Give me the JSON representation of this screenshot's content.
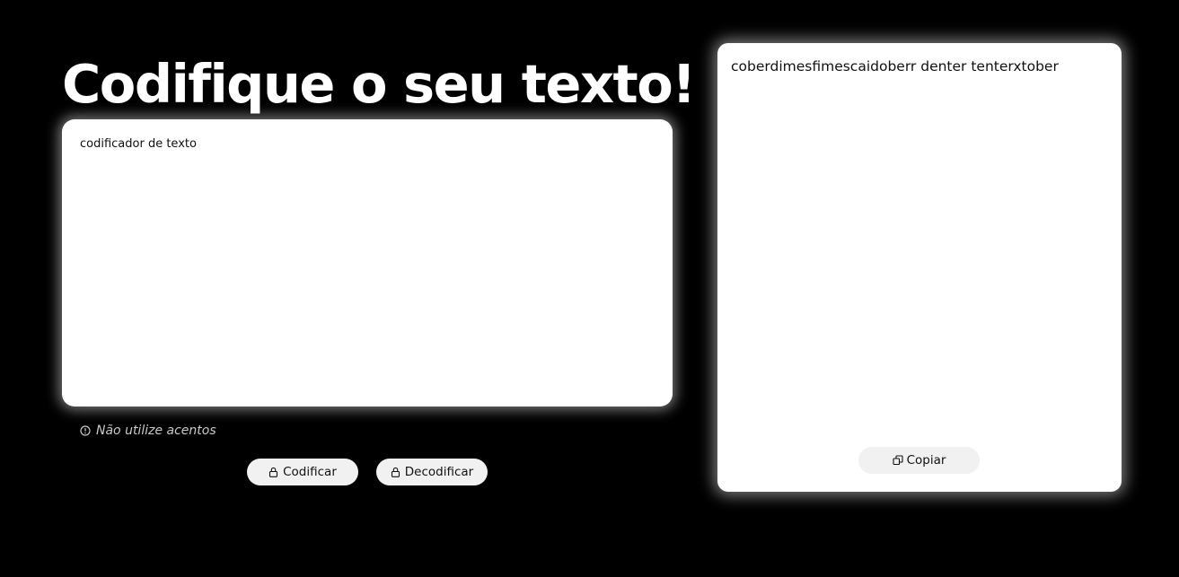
{
  "header": {
    "title": "Codifique o seu texto!"
  },
  "input": {
    "value": "codificador de texto",
    "placeholder": ""
  },
  "hint": {
    "icon": "alert-circle-icon",
    "text": "Não utilize acentos"
  },
  "actions": {
    "encrypt_label": "Codificar",
    "encrypt_icon": "lock-icon",
    "decrypt_label": "Decodificar",
    "decrypt_icon": "unlock-icon"
  },
  "output": {
    "text": "coberdimesfimescaidoberr denter tenterxtober",
    "copy_label": "Copiar",
    "copy_icon": "copy-icon"
  },
  "colors": {
    "background": "#000000",
    "card": "#ffffff",
    "button": "#f1f1f1",
    "hint_text": "#c9c9c9"
  }
}
